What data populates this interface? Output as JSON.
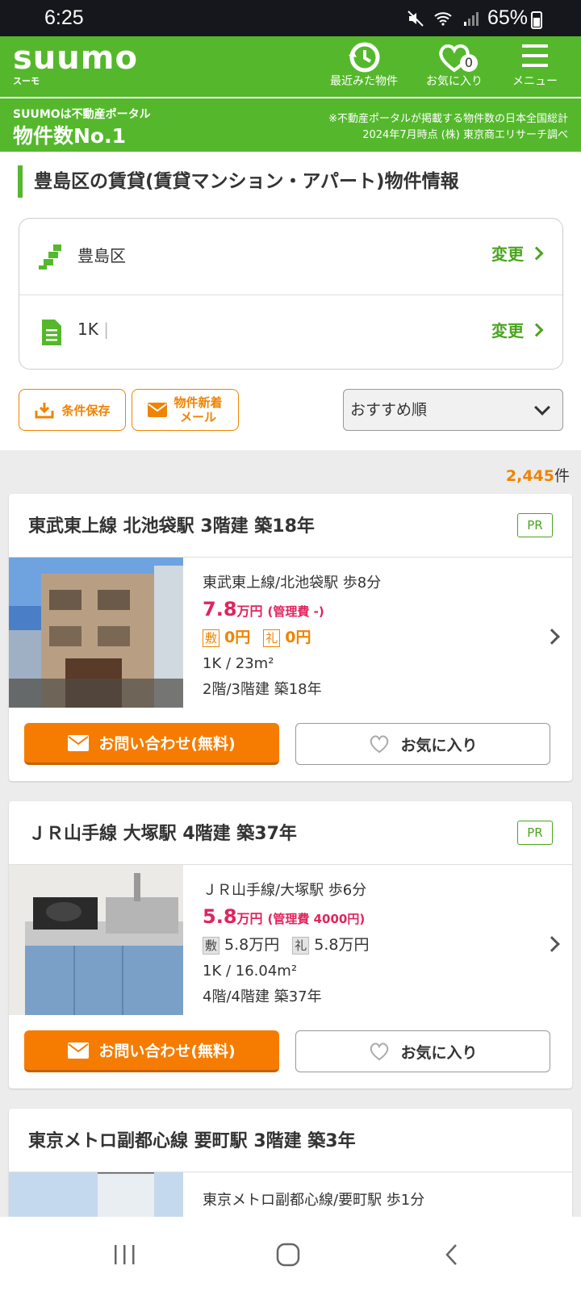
{
  "status": {
    "time": "6:25",
    "battery": "65%"
  },
  "header": {
    "logo": "suumo",
    "logo_sub": "スーモ",
    "nav": [
      {
        "label": "最近みた物件",
        "icon": "history-icon"
      },
      {
        "label": "お気に入り",
        "icon": "heart-icon",
        "count": "0"
      },
      {
        "label": "メニュー",
        "icon": "menu-icon"
      }
    ]
  },
  "banner": {
    "line1": "SUUMOは不動産ポータル",
    "line2": "物件数No.1",
    "note1": "※不動産ポータルが掲載する物件数の日本全国総計",
    "note2": "2024年7月時点 (株) 東京商エリサーチ調べ"
  },
  "page_title": "豊島区の賃貸(賃貸マンション・アパート)物件情報",
  "conditions": [
    {
      "value": "豊島区",
      "change": "変更",
      "icon": "area-icon"
    },
    {
      "value": "1K",
      "change": "変更",
      "icon": "document-icon"
    }
  ],
  "actions": {
    "save": "条件保存",
    "mail_line1": "物件新着",
    "mail_line2": "メール",
    "sort": "おすすめ順"
  },
  "result_count": {
    "number": "2,445",
    "unit": "件"
  },
  "listings": [
    {
      "title": "東武東上線 北池袋駅 3階建 築18年",
      "pr": "PR",
      "access": "東武東上線/北池袋駅 歩8分",
      "rent_num": "7.8",
      "rent_unit": "万円",
      "mgmt": "(管理費 -)",
      "deposit_label": "敷",
      "deposit": "0円",
      "key_label": "礼",
      "key": "0円",
      "layout": "1K / 23m²",
      "floor": "2階/3階建 築18年",
      "contact": "お問い合わせ(無料)",
      "favorite": "お気に入り"
    },
    {
      "title": "ＪＲ山手線 大塚駅 4階建 築37年",
      "pr": "PR",
      "access": "ＪＲ山手線/大塚駅 歩6分",
      "rent_num": "5.8",
      "rent_unit": "万円",
      "mgmt": "(管理費 4000円)",
      "deposit_label": "敷",
      "deposit": "5.8万円",
      "key_label": "礼",
      "key": "5.8万円",
      "layout": "1K / 16.04m²",
      "floor": "4階/4階建 築37年",
      "contact": "お問い合わせ(無料)",
      "favorite": "お気に入り"
    },
    {
      "title": "東京メトロ副都心線 要町駅 3階建 築3年",
      "access": "東京メトロ副都心線/要町駅 歩1分"
    }
  ]
}
